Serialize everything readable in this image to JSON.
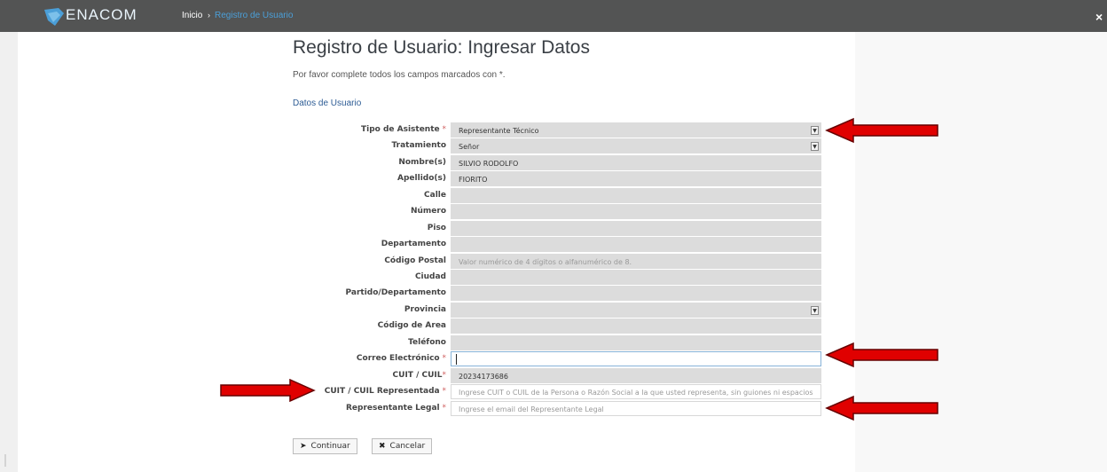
{
  "header": {
    "logo_text": "ENACOM",
    "breadcrumb_home": "Inicio",
    "breadcrumb_sep": "›",
    "breadcrumb_current": "Registro de Usuario",
    "close_label": "×",
    "logo_color": "#4b9fd8",
    "bar_color": "#535454"
  },
  "page": {
    "title": "Registro de Usuario: Ingresar Datos",
    "subtitle": "Por favor complete todos los campos marcados con *.",
    "section": "Datos de Usuario"
  },
  "form": {
    "tipo": {
      "label": "Tipo de Asistente",
      "req": " *",
      "value": "Representante Técnico"
    },
    "tratamiento": {
      "label": "Tratamiento",
      "value": "Señor"
    },
    "nombre": {
      "label": "Nombre(s)",
      "value": "SILVIO RODOLFO"
    },
    "apellido": {
      "label": "Apellido(s)",
      "value": "FIORITO"
    },
    "calle": {
      "label": "Calle",
      "value": ""
    },
    "numero": {
      "label": "Número",
      "value": ""
    },
    "piso": {
      "label": "Piso",
      "value": ""
    },
    "depto": {
      "label": "Departamento",
      "value": ""
    },
    "cp": {
      "label": "Código Postal",
      "placeholder": "Valor numérico de 4 dígitos o alfanumérico de 8."
    },
    "ciudad": {
      "label": "Ciudad",
      "value": ""
    },
    "partido": {
      "label": "Partido/Departamento",
      "value": ""
    },
    "provincia": {
      "label": "Provincia",
      "value": ""
    },
    "area": {
      "label": "Código de Area",
      "value": ""
    },
    "telefono": {
      "label": "Teléfono",
      "value": ""
    },
    "correo": {
      "label": "Correo Electrónico",
      "req": " *",
      "value": ""
    },
    "cuit": {
      "label": "CUIT / CUIL",
      "req": "*",
      "value": "20234173686"
    },
    "cuit_rep": {
      "label": "CUIT / CUIL Representada",
      "req": " *",
      "placeholder": "Ingrese CUIT o CUIL de la Persona o Razón Social a la que usted representa, sin guiones ni espacios"
    },
    "rep_legal": {
      "label": "Representante Legal",
      "req": " *",
      "placeholder": "Ingrese el email del Representante Legal"
    }
  },
  "buttons": {
    "continuar": "Continuar",
    "continuar_icon": "➤",
    "cancelar": "Cancelar",
    "cancelar_icon": "✖"
  },
  "annotation_color": "#e00000"
}
